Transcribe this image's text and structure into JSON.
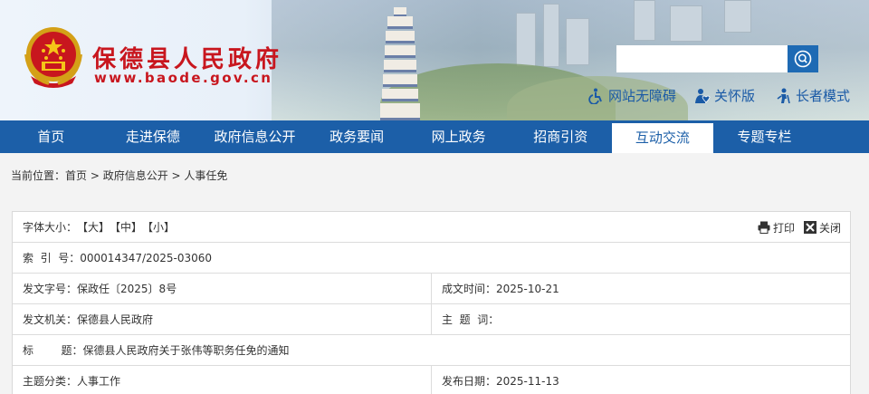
{
  "header": {
    "site_title": "保德县人民政府",
    "site_url": "www.baode.gov.cn",
    "search": {
      "placeholder": "",
      "value": ""
    },
    "tools": [
      {
        "icon": "wheelchair-icon",
        "label": "网站无障碍"
      },
      {
        "icon": "care-icon",
        "label": "关怀版"
      },
      {
        "icon": "elder-icon",
        "label": "长者模式"
      }
    ]
  },
  "nav": {
    "items": [
      {
        "label": "首页"
      },
      {
        "label": "走进保德"
      },
      {
        "label": "政府信息公开"
      },
      {
        "label": "政务要闻"
      },
      {
        "label": "网上政务"
      },
      {
        "label": "招商引资"
      },
      {
        "label": "互动交流",
        "active": true
      },
      {
        "label": "专题专栏"
      }
    ]
  },
  "breadcrumb": {
    "prefix": "当前位置：",
    "items": [
      "首页",
      "政府信息公开",
      "人事任免"
    ],
    "sep": " > "
  },
  "panel": {
    "font_size_label": "字体大小：",
    "sizes": [
      "【大】",
      "【中】",
      "【小】"
    ],
    "print_label": "打印",
    "close_label": "关闭",
    "index_label": "索  引  号：",
    "index_value": "000014347/2025-03060",
    "doc_no_label": "发文字号：",
    "doc_no_value": "保政任〔2025〕8号",
    "created_label": "成文时间：",
    "created_value": "2025-10-21",
    "issuer_label": "发文机关：",
    "issuer_value": "保德县人民政府",
    "keywords_label": "主  题  词：",
    "keywords_value": "",
    "title_label": "标        题：",
    "title_value": "保德县人民政府关于张伟等职务任免的通知",
    "category_label": "主题分类：",
    "category_value": "人事工作",
    "published_label": "发布日期：",
    "published_value": "2025-11-13"
  },
  "colors": {
    "brand_red": "#c8161e",
    "nav_blue": "#1c5fa8",
    "search_btn": "#1e6ab4"
  }
}
